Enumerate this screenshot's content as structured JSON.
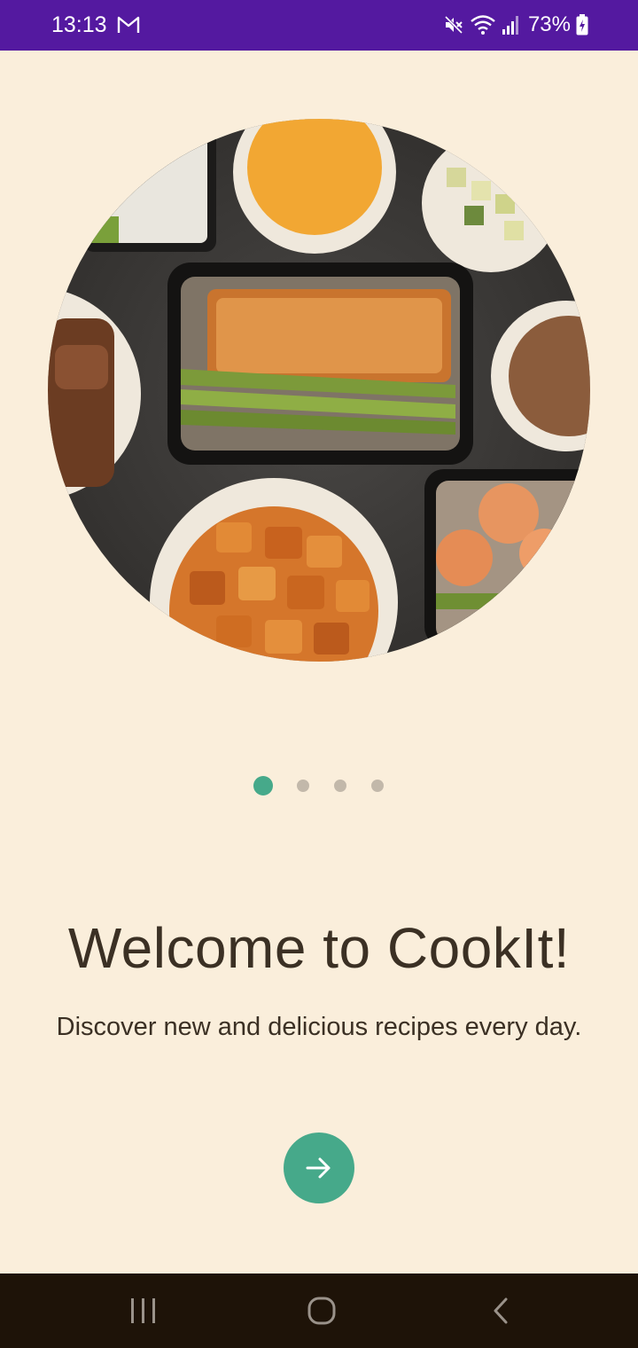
{
  "status_bar": {
    "time": "13:13",
    "battery": "73%",
    "icons": [
      "gmail-icon",
      "mute-icon",
      "wifi-icon",
      "signal-icon",
      "battery-charging-icon"
    ],
    "bg_color": "#5419A0"
  },
  "onboarding": {
    "title": "Welcome to CookIt!",
    "subtitle": "Discover new and delicious recipes every day.",
    "page_indicator": {
      "current": 1,
      "total": 4
    },
    "next_button_icon": "arrow-right-icon",
    "hero_image": "meal-prep-food-photo"
  },
  "colors": {
    "background": "#FAEEDB",
    "accent": "#46A98A",
    "text": "#3B3024",
    "dot_inactive": "#C2B8AA",
    "nav_bar": "#1E1308"
  },
  "nav_bar": {
    "icons": [
      "recent-apps-icon",
      "home-icon",
      "back-icon"
    ]
  }
}
